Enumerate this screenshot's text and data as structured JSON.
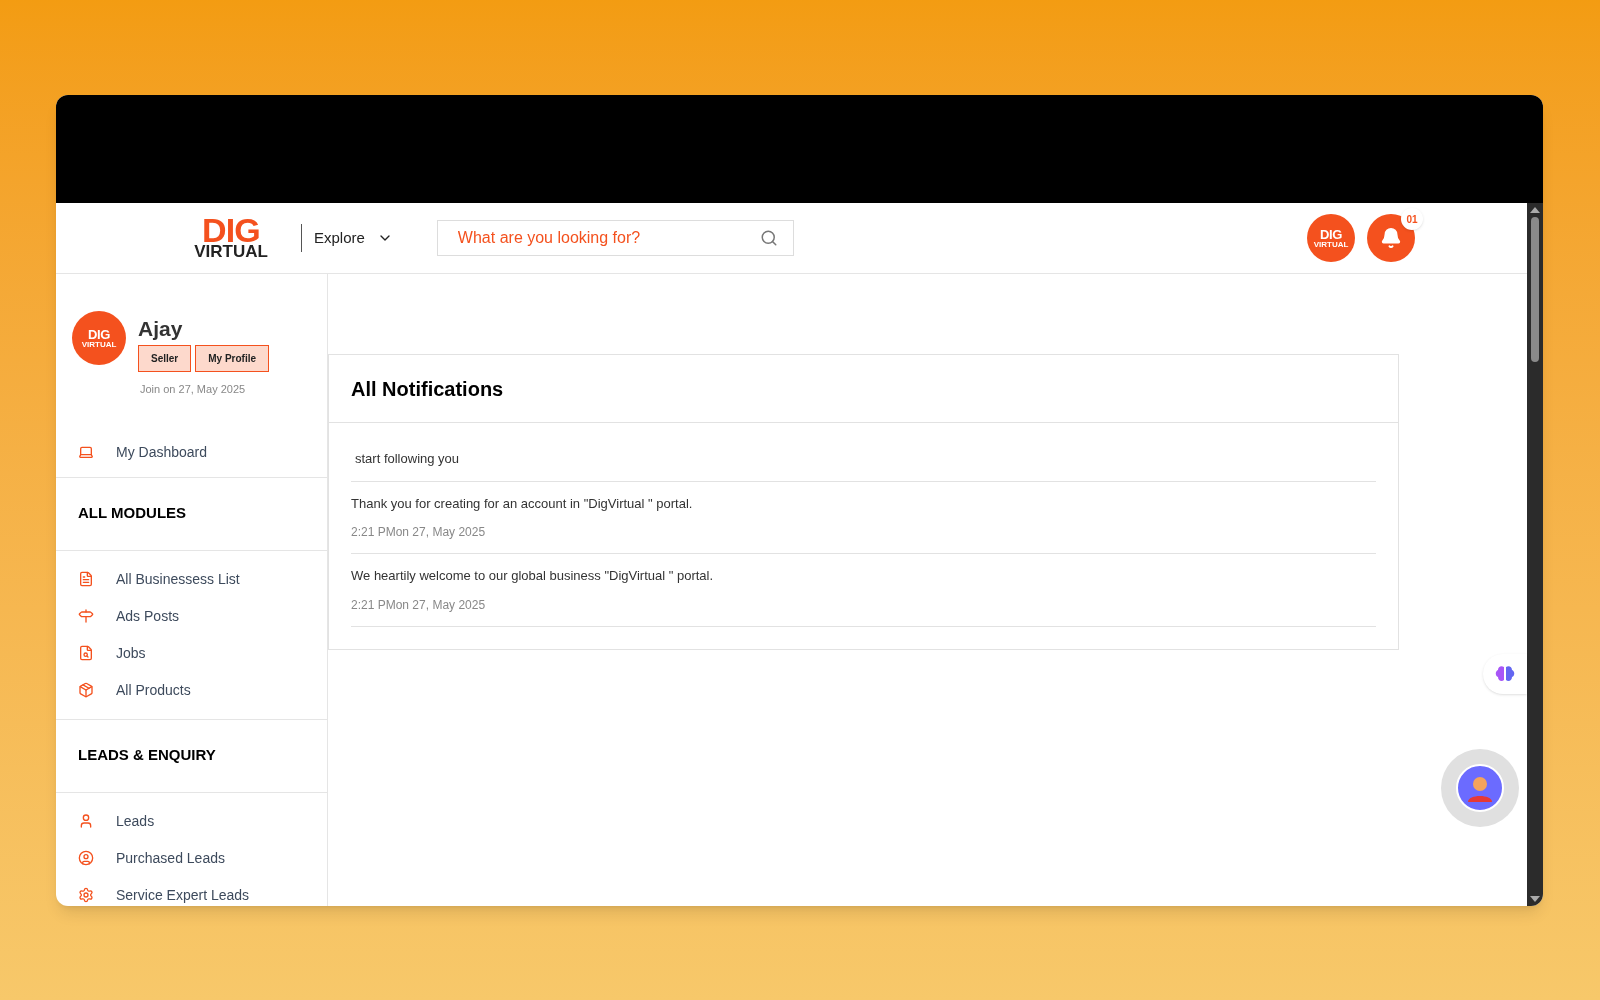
{
  "header": {
    "logo": {
      "top": "DIG",
      "bottom": "VIRTUAL"
    },
    "explore": "Explore",
    "search": {
      "placeholder": "What are you looking for?"
    },
    "avatar_logo": {
      "top": "DIG",
      "bottom": "VIRTUAL"
    },
    "notification_count": "01"
  },
  "sidebar": {
    "profile": {
      "logo": {
        "top": "DIG",
        "bottom": "VIRTUAL"
      },
      "name": "Ajay",
      "badges": [
        "Seller",
        "My Profile"
      ],
      "joined": "Join on 27, May 2025"
    },
    "sections": [
      {
        "items": [
          {
            "label": "My Dashboard"
          }
        ]
      },
      {
        "heading": "ALL MODULES",
        "items": [
          {
            "label": "All Businessess List"
          },
          {
            "label": "Ads Posts"
          },
          {
            "label": "Jobs"
          },
          {
            "label": "All Products"
          }
        ]
      },
      {
        "heading": "LEADS & ENQUIRY",
        "items": [
          {
            "label": "Leads"
          },
          {
            "label": "Purchased Leads"
          },
          {
            "label": "Service Expert Leads"
          }
        ]
      }
    ]
  },
  "notifications": {
    "title": "All Notifications",
    "items": [
      {
        "message": "start following you"
      },
      {
        "message": "Thank you for creating for an account in \"DigVirtual \" portal.",
        "time": "2:21 PMon 27, May 2025"
      },
      {
        "message": "We heartily welcome to our global business \"DigVirtual \" portal.",
        "time": "2:21 PMon 27, May 2025"
      }
    ]
  }
}
